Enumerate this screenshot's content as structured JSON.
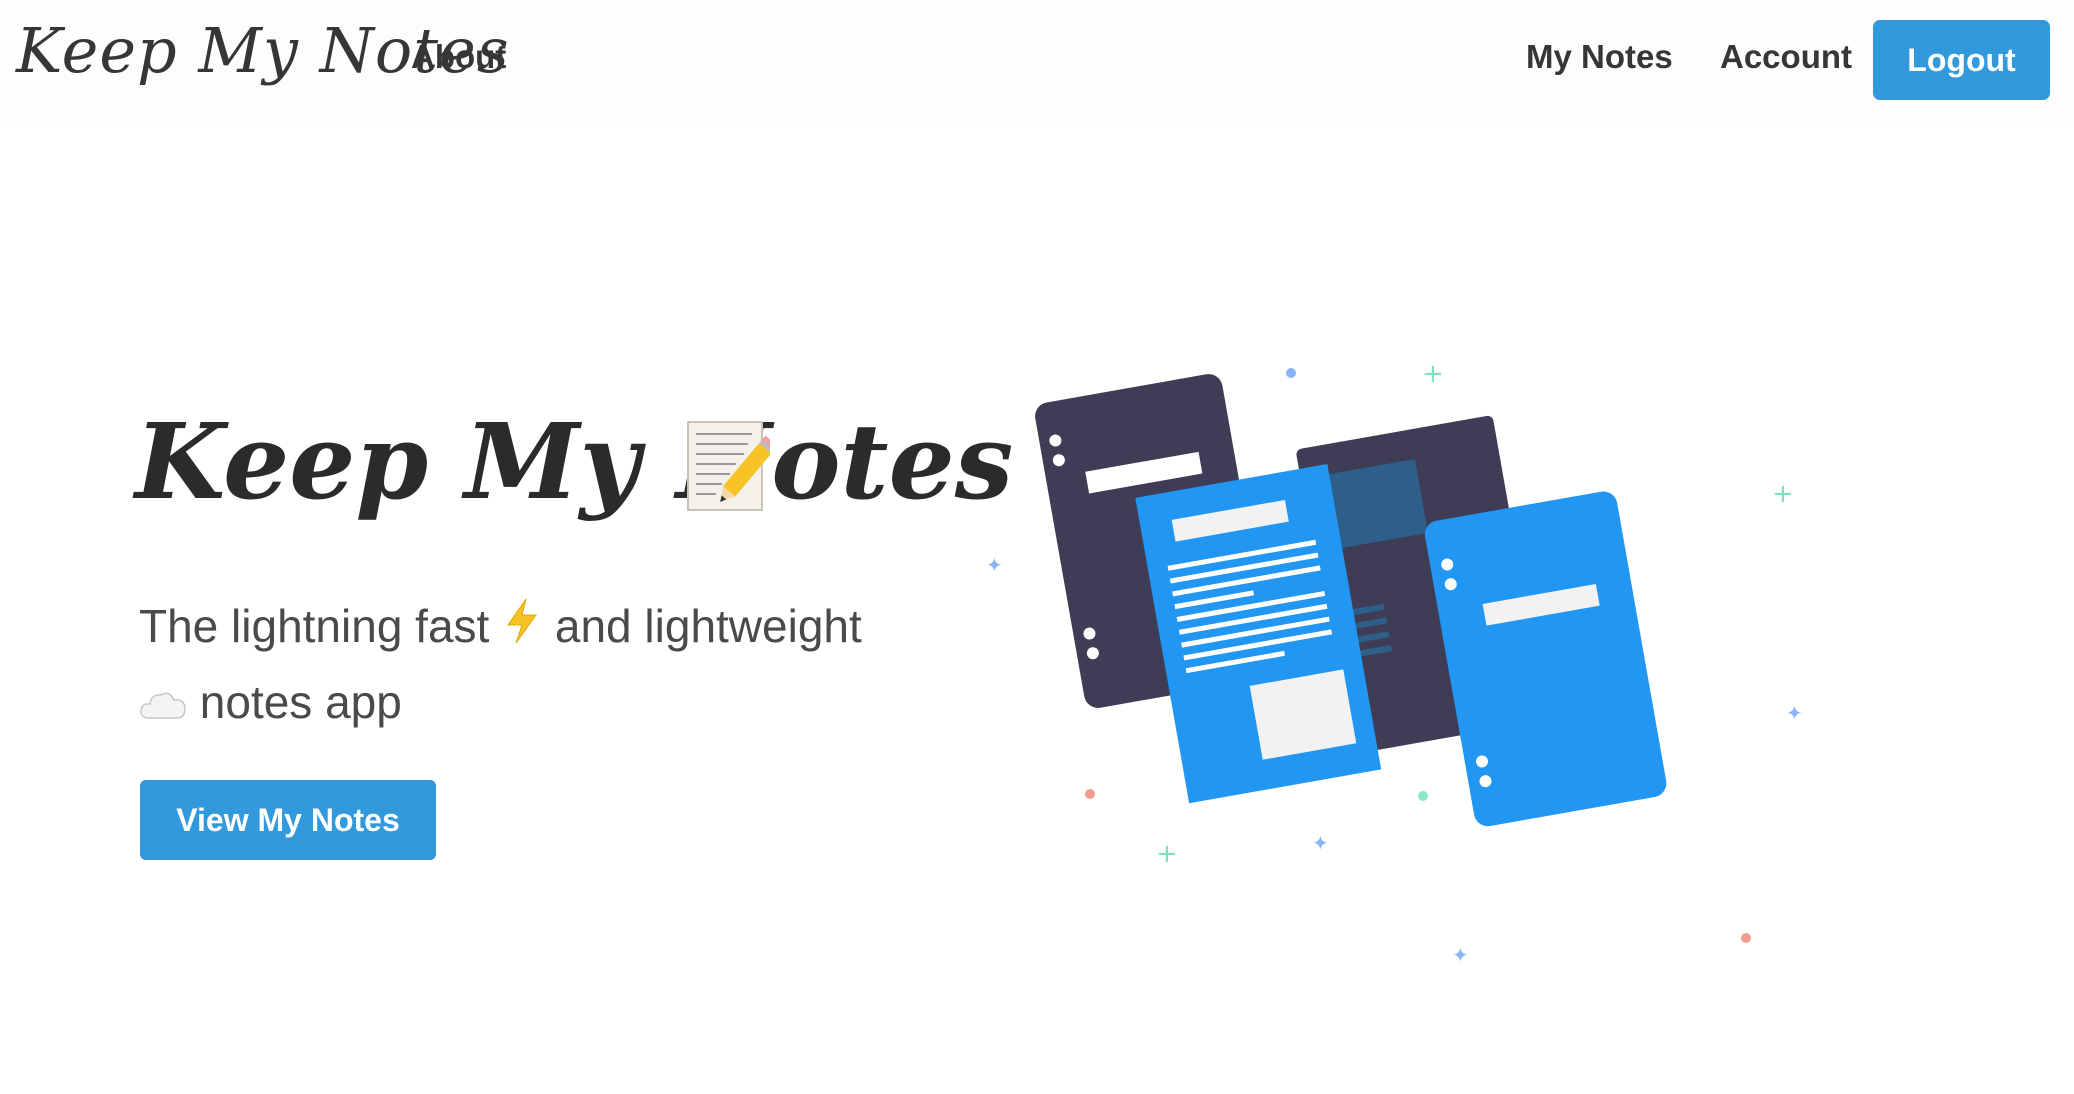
{
  "navbar": {
    "brand": "Keep My Notes",
    "about": "About",
    "my_notes": "My Notes",
    "account": "Account",
    "logout": "Logout"
  },
  "hero": {
    "title": "Keep My Notes",
    "title_icon": "memo-icon",
    "subtitle_part1": "The lightning fast",
    "subtitle_icon1": "lightning-icon",
    "subtitle_part2": "and lightweight",
    "subtitle_icon2": "cloud-icon",
    "subtitle_part3": "notes app",
    "cta": "View My Notes"
  },
  "colors": {
    "accent": "#3399dd",
    "dark_note": "#3f3d56",
    "blue_note": "#2196f3"
  }
}
